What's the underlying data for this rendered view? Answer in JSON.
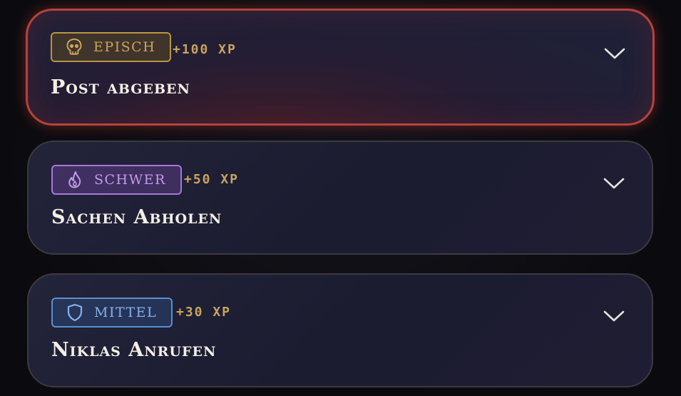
{
  "quests": [
    {
      "difficulty": "EPISCH",
      "icon": "skull-icon",
      "xp": "+100 XP",
      "title": "Post abgeben",
      "color": "#c9a55a",
      "border": "#b6423e"
    },
    {
      "difficulty": "SCHWER",
      "icon": "flame-icon",
      "xp": "+50 XP",
      "title": "Sachen Abholen",
      "color": "#c29ae8"
    },
    {
      "difficulty": "MITTEL",
      "icon": "shield-icon",
      "xp": "+30 XP",
      "title": "Niklas Anrufen",
      "color": "#86b2ea"
    }
  ],
  "colors": {
    "background": "#0c0c10",
    "card": "#1f2037",
    "xp": "#c8a45e",
    "title": "#f3efe6",
    "chevron": "#e8e4dc"
  }
}
